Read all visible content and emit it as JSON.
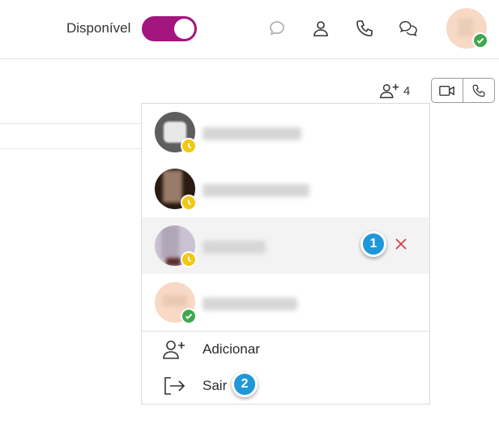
{
  "header": {
    "status_label": "Disponível",
    "status_toggle_on": true,
    "toggle_color": "#a3157f",
    "icons": [
      "chat-bubble-icon",
      "user-icon",
      "phone-icon",
      "conversations-icon"
    ],
    "self_status": "available"
  },
  "subbar": {
    "participants_count": "4",
    "call_buttons": [
      "video-camera-icon",
      "phone-icon"
    ]
  },
  "participants": [
    {
      "status": "pending",
      "avatar_color": "#5e5e5e",
      "highlighted": false
    },
    {
      "status": "pending",
      "avatar_color": "#2a1a12",
      "highlighted": false
    },
    {
      "status": "pending",
      "avatar_color": "#c9c2d2",
      "highlighted": true,
      "removable": true
    },
    {
      "status": "available",
      "avatar_color": "#f7d9c6",
      "highlighted": false
    }
  ],
  "menu": {
    "add_label": "Adicionar",
    "leave_label": "Sair"
  },
  "annotations": {
    "step1": "1",
    "step2": "2",
    "badge_color": "#1f97d8"
  },
  "colors": {
    "available_badge": "#3fa84f",
    "pending_badge": "#f3c812",
    "remove_x": "#d23c3c"
  }
}
